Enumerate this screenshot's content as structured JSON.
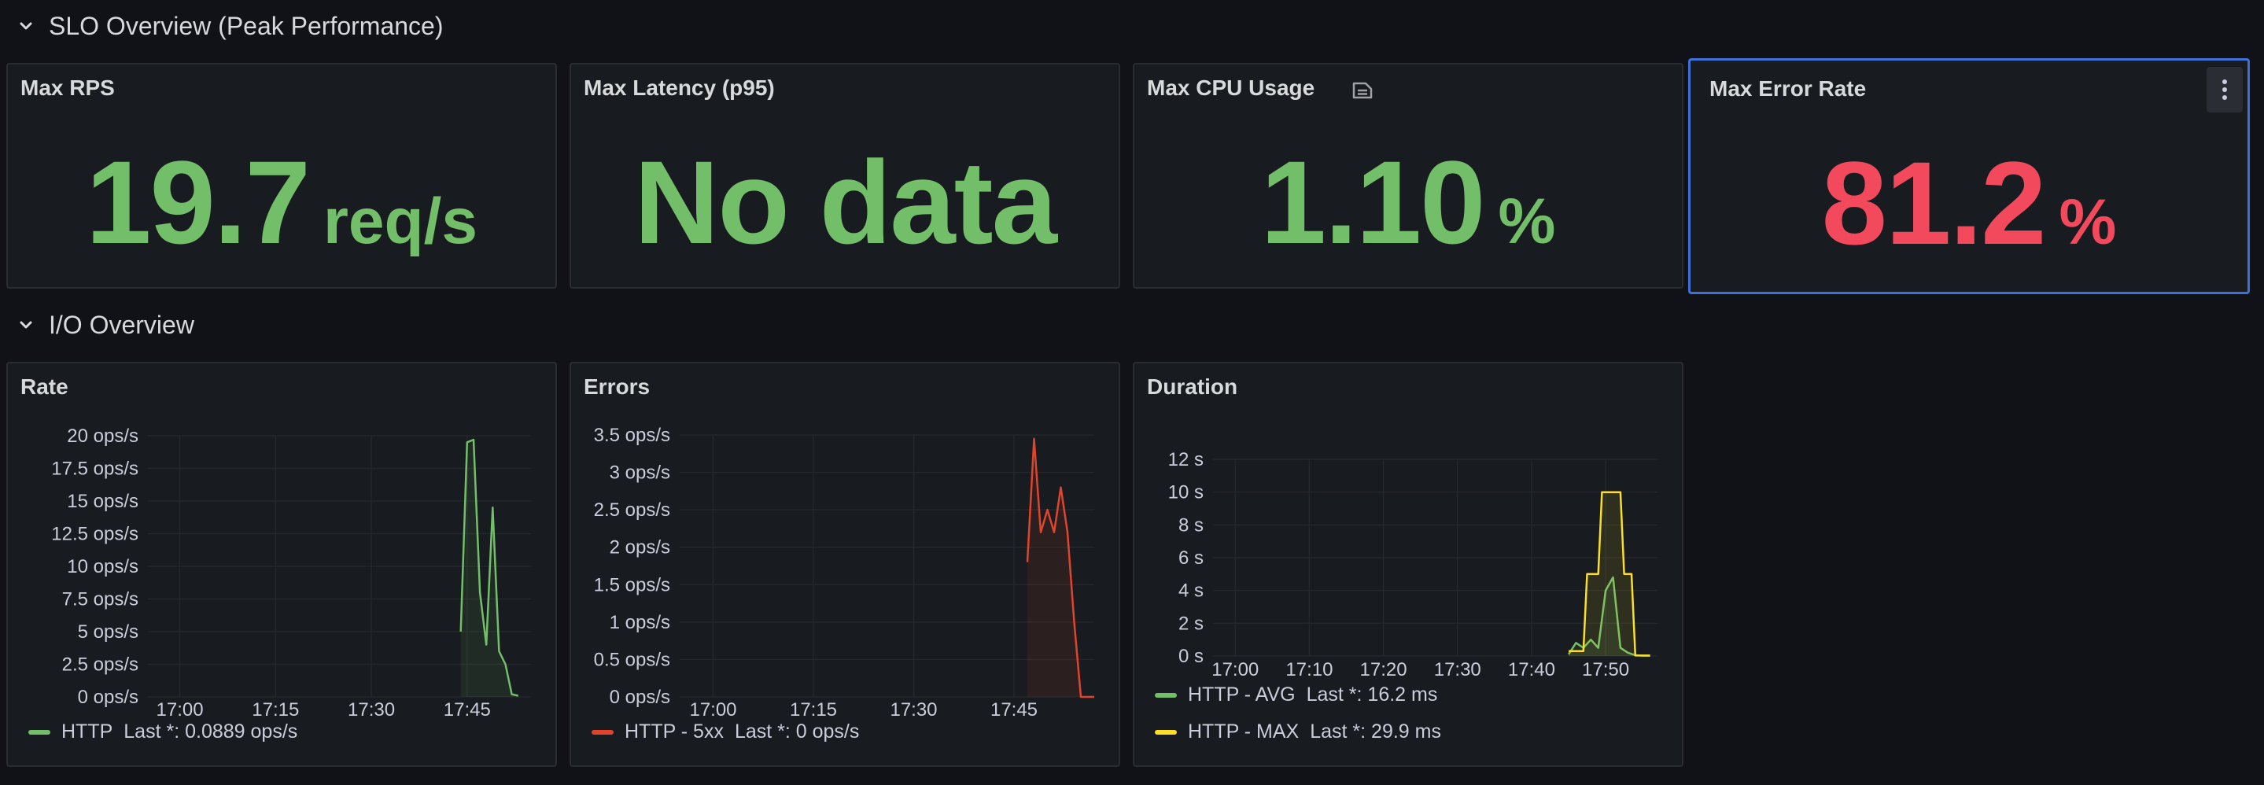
{
  "rows": {
    "slo": {
      "title": "SLO Overview (Peak Performance)"
    },
    "io": {
      "title": "I/O Overview"
    }
  },
  "stats": {
    "max_rps": {
      "title": "Max RPS",
      "value": "19.7",
      "unit": "req/s",
      "color": "#73bf69"
    },
    "max_latency": {
      "title": "Max Latency (p95)",
      "value": "No data",
      "color": "#73bf69"
    },
    "max_cpu": {
      "title": "Max CPU Usage",
      "value": "1.10",
      "unit": "%",
      "color": "#73bf69",
      "icon": "doc-icon"
    },
    "max_error": {
      "title": "Max Error Rate",
      "value": "81.2",
      "unit": "%",
      "color": "#f2495c",
      "icon": "menu-dots-icon"
    }
  },
  "panels": {
    "rate": {
      "title": "Rate"
    },
    "errors": {
      "title": "Errors"
    },
    "duration": {
      "title": "Duration"
    }
  },
  "chart_data": [
    {
      "type": "line",
      "title": "Rate",
      "y_ticks": [
        "0 ops/s",
        "2.5 ops/s",
        "5 ops/s",
        "7.5 ops/s",
        "10 ops/s",
        "12.5 ops/s",
        "15 ops/s",
        "17.5 ops/s",
        "20 ops/s"
      ],
      "x_ticks": [
        "17:00",
        "17:15",
        "17:30",
        "17:45"
      ],
      "ylim": [
        0,
        20
      ],
      "series": [
        {
          "name": "HTTP",
          "color": "#73bf69",
          "x": [
            "17:44",
            "17:45",
            "17:46",
            "17:47",
            "17:48",
            "17:49",
            "17:50",
            "17:51",
            "17:52",
            "17:53"
          ],
          "values": [
            5,
            19.5,
            19.7,
            8,
            4,
            14.5,
            3.5,
            2.5,
            0.2,
            0.09
          ]
        }
      ],
      "legend": {
        "name": "HTTP",
        "last": "Last *: 0.0889 ops/s"
      }
    },
    {
      "type": "line",
      "title": "Errors",
      "y_ticks": [
        "0 ops/s",
        "0.5 ops/s",
        "1 ops/s",
        "1.5 ops/s",
        "2 ops/s",
        "2.5 ops/s",
        "3 ops/s",
        "3.5 ops/s"
      ],
      "x_ticks": [
        "17:00",
        "17:15",
        "17:30",
        "17:45"
      ],
      "ylim": [
        0,
        3.5
      ],
      "series": [
        {
          "name": "HTTP - 5xx",
          "color": "#e0452b",
          "x": [
            "17:47",
            "17:48",
            "17:49",
            "17:50",
            "17:51",
            "17:52",
            "17:53",
            "17:54",
            "17:55",
            "17:56",
            "17:57"
          ],
          "values": [
            1.8,
            3.45,
            2.2,
            2.5,
            2.2,
            2.8,
            2.2,
            1.0,
            0,
            0,
            0
          ]
        }
      ],
      "legend": {
        "name": "HTTP - 5xx",
        "last": "Last *: 0 ops/s"
      }
    },
    {
      "type": "line",
      "title": "Duration",
      "y_ticks": [
        "0 s",
        "2 s",
        "4 s",
        "6 s",
        "8 s",
        "10 s",
        "12 s"
      ],
      "x_ticks": [
        "17:00",
        "17:10",
        "17:20",
        "17:30",
        "17:40",
        "17:50"
      ],
      "ylim": [
        0,
        12
      ],
      "series": [
        {
          "name": "HTTP - AVG",
          "color": "#73bf69",
          "x": [
            "17:45",
            "17:46",
            "17:47",
            "17:48",
            "17:49",
            "17:50",
            "17:51",
            "17:52",
            "17:53",
            "17:54",
            "17:55",
            "17:56"
          ],
          "values": [
            0.1,
            0.8,
            0.5,
            1.0,
            0.5,
            4.0,
            4.8,
            0.5,
            0.2,
            0.05,
            0.02,
            0.02
          ]
        },
        {
          "name": "HTTP - MAX",
          "color": "#fade2a",
          "x": [
            "17:45",
            "17:47",
            "17:47.5",
            "17:49",
            "17:49.5",
            "17:52",
            "17:52.5",
            "17:53.5",
            "17:54",
            "17:56"
          ],
          "values": [
            0.3,
            0.3,
            5.0,
            5.0,
            10.0,
            10.0,
            5.0,
            5.0,
            0.03,
            0.03
          ]
        }
      ],
      "legend": [
        {
          "name": "HTTP - AVG",
          "last": "Last *: 16.2 ms"
        },
        {
          "name": "HTTP - MAX",
          "last": "Last *: 29.9 ms"
        }
      ]
    }
  ]
}
